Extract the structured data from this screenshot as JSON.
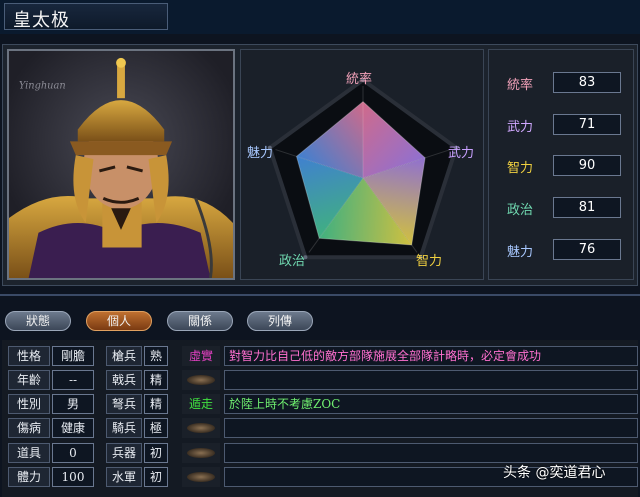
{
  "character": {
    "name": "皇太极"
  },
  "portrait": {
    "watermark": "Yinghuan"
  },
  "radar": {
    "axes": [
      {
        "label": "統率",
        "value": 83,
        "color": "#f0a0b8"
      },
      {
        "label": "武力",
        "value": 71,
        "color": "#c8a0ff"
      },
      {
        "label": "智力",
        "value": 90,
        "color": "#f0d040"
      },
      {
        "label": "政治",
        "value": 81,
        "color": "#70d8b0"
      },
      {
        "label": "魅力",
        "value": 76,
        "color": "#a8c8ff"
      }
    ],
    "max": 100
  },
  "stats": [
    {
      "label": "統率",
      "value": "83",
      "color": "#f0a0b8"
    },
    {
      "label": "武力",
      "value": "71",
      "color": "#d0a8ff"
    },
    {
      "label": "智力",
      "value": "90",
      "color": "#f0d040"
    },
    {
      "label": "政治",
      "value": "81",
      "color": "#70d8b0"
    },
    {
      "label": "魅力",
      "value": "76",
      "color": "#a8c8ff"
    }
  ],
  "tabs": [
    {
      "label": "狀態",
      "active": false
    },
    {
      "label": "個人",
      "active": true
    },
    {
      "label": "關係",
      "active": false
    },
    {
      "label": "列傳",
      "active": false
    }
  ],
  "profile": [
    {
      "label": "性格",
      "value": "剛膽"
    },
    {
      "label": "年齡",
      "value": "--"
    },
    {
      "label": "性別",
      "value": "男"
    },
    {
      "label": "傷病",
      "value": "健康"
    },
    {
      "label": "道具",
      "value": "0"
    },
    {
      "label": "體力",
      "value": "100"
    }
  ],
  "units": [
    {
      "label": "槍兵",
      "grade": "熟"
    },
    {
      "label": "戟兵",
      "grade": "精"
    },
    {
      "label": "弩兵",
      "grade": "精"
    },
    {
      "label": "騎兵",
      "grade": "極"
    },
    {
      "label": "兵器",
      "grade": "初"
    },
    {
      "label": "水軍",
      "grade": "初"
    }
  ],
  "skills": [
    {
      "tag": "虛實",
      "tag_color": "#e040c0",
      "desc": "對智力比自己低的敵方部隊施展全部隊計略時，必定會成功",
      "desc_color": "#ff70d0"
    },
    {
      "tag": "",
      "desc": ""
    },
    {
      "tag": "",
      "desc": ""
    },
    {
      "tag": "遁走",
      "tag_color": "#40e040",
      "desc": "於陸上時不考慮ZOC",
      "desc_color": "#70f070"
    },
    {
      "tag": "",
      "desc": ""
    },
    {
      "tag": "",
      "desc": ""
    },
    {
      "tag": "",
      "desc": ""
    }
  ],
  "footer": {
    "watermark": "头条 @奕道君心"
  }
}
